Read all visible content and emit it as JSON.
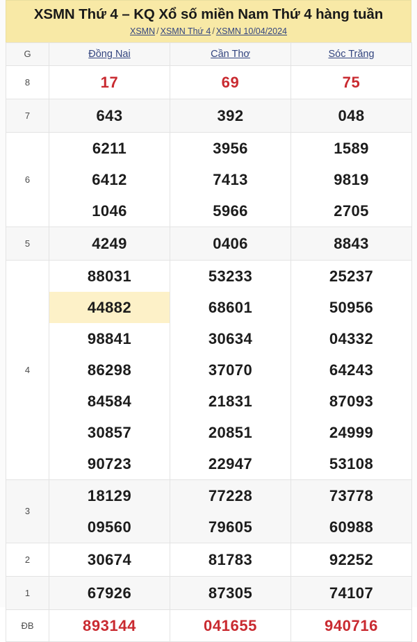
{
  "header": {
    "title": "XSMN Thứ 4 – KQ Xổ số miền Nam Thứ 4 hàng tuần",
    "breadcrumb": {
      "items": [
        "XSMN",
        "XSMN Thứ 4",
        "XSMN 10/04/2024"
      ],
      "separator": "/"
    },
    "background_color": "#f8e9a6"
  },
  "table": {
    "columns": [
      "G",
      "Đồng Nai",
      "Cần Thơ",
      "Sóc Trăng"
    ],
    "highlight_color": "#fdf1c8",
    "special_color": "#c92a30",
    "link_color": "#33457f",
    "rows": [
      {
        "prize": "8",
        "style": "special",
        "values": {
          "dong_nai": [
            "17"
          ],
          "can_tho": [
            "69"
          ],
          "soc_trang": [
            "75"
          ]
        }
      },
      {
        "prize": "7",
        "style": "normal",
        "values": {
          "dong_nai": [
            "643"
          ],
          "can_tho": [
            "392"
          ],
          "soc_trang": [
            "048"
          ]
        }
      },
      {
        "prize": "6",
        "style": "normal",
        "values": {
          "dong_nai": [
            "6211",
            "6412",
            "1046"
          ],
          "can_tho": [
            "3956",
            "7413",
            "5966"
          ],
          "soc_trang": [
            "1589",
            "9819",
            "2705"
          ]
        }
      },
      {
        "prize": "5",
        "style": "normal",
        "values": {
          "dong_nai": [
            "4249"
          ],
          "can_tho": [
            "0406"
          ],
          "soc_trang": [
            "8843"
          ]
        }
      },
      {
        "prize": "4",
        "style": "normal",
        "values": {
          "dong_nai": [
            "88031",
            "44882",
            "98841",
            "86298",
            "84584",
            "30857",
            "90723"
          ],
          "can_tho": [
            "53233",
            "68601",
            "30634",
            "37070",
            "21831",
            "20851",
            "22947"
          ],
          "soc_trang": [
            "25237",
            "50956",
            "04332",
            "64243",
            "87093",
            "24999",
            "53108"
          ]
        },
        "highlighted": {
          "column": "dong_nai",
          "index": 1,
          "value": "44882"
        }
      },
      {
        "prize": "3",
        "style": "normal",
        "values": {
          "dong_nai": [
            "18129",
            "09560"
          ],
          "can_tho": [
            "77228",
            "79605"
          ],
          "soc_trang": [
            "73778",
            "60988"
          ]
        }
      },
      {
        "prize": "2",
        "style": "normal",
        "values": {
          "dong_nai": [
            "30674"
          ],
          "can_tho": [
            "81783"
          ],
          "soc_trang": [
            "92252"
          ]
        }
      },
      {
        "prize": "1",
        "style": "normal",
        "values": {
          "dong_nai": [
            "67926"
          ],
          "can_tho": [
            "87305"
          ],
          "soc_trang": [
            "74107"
          ]
        }
      },
      {
        "prize": "ĐB",
        "style": "special",
        "values": {
          "dong_nai": [
            "893144"
          ],
          "can_tho": [
            "041655"
          ],
          "soc_trang": [
            "940716"
          ]
        }
      }
    ]
  }
}
